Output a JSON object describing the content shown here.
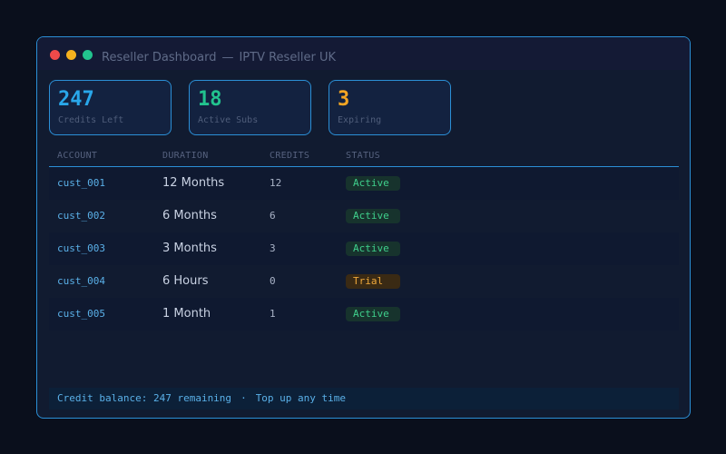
{
  "window": {
    "title": "Reseller Dashboard",
    "separator": "—",
    "subtitle": "IPTV Reseller UK",
    "controls": [
      "close",
      "minimize",
      "maximize"
    ]
  },
  "stats": [
    {
      "value": "247",
      "label": "Credits Left",
      "color": "#29a7ea"
    },
    {
      "value": "18",
      "label": "Active Subs",
      "color": "#22c38e"
    },
    {
      "value": "3",
      "label": "Expiring",
      "color": "#f5a623"
    }
  ],
  "table": {
    "headers": [
      "ACCOUNT",
      "DURATION",
      "CREDITS",
      "STATUS"
    ],
    "rows": [
      {
        "account": "cust_001",
        "duration": "12 Months",
        "credits": "12",
        "status": "Active"
      },
      {
        "account": "cust_002",
        "duration": "6 Months",
        "credits": "6",
        "status": "Active"
      },
      {
        "account": "cust_003",
        "duration": "3 Months",
        "credits": "3",
        "status": "Active"
      },
      {
        "account": "cust_004",
        "duration": "6 Hours",
        "credits": "0",
        "status": "Trial"
      },
      {
        "account": "cust_005",
        "duration": "1 Month",
        "credits": "1",
        "status": "Active"
      }
    ]
  },
  "footer": {
    "balance_text": "Credit balance: 247 remaining",
    "separator": "·",
    "topup_text": "Top up any time"
  },
  "colors": {
    "accent": "#2b8fd6",
    "active": "#3fd08c",
    "trial": "#f0a93b"
  }
}
